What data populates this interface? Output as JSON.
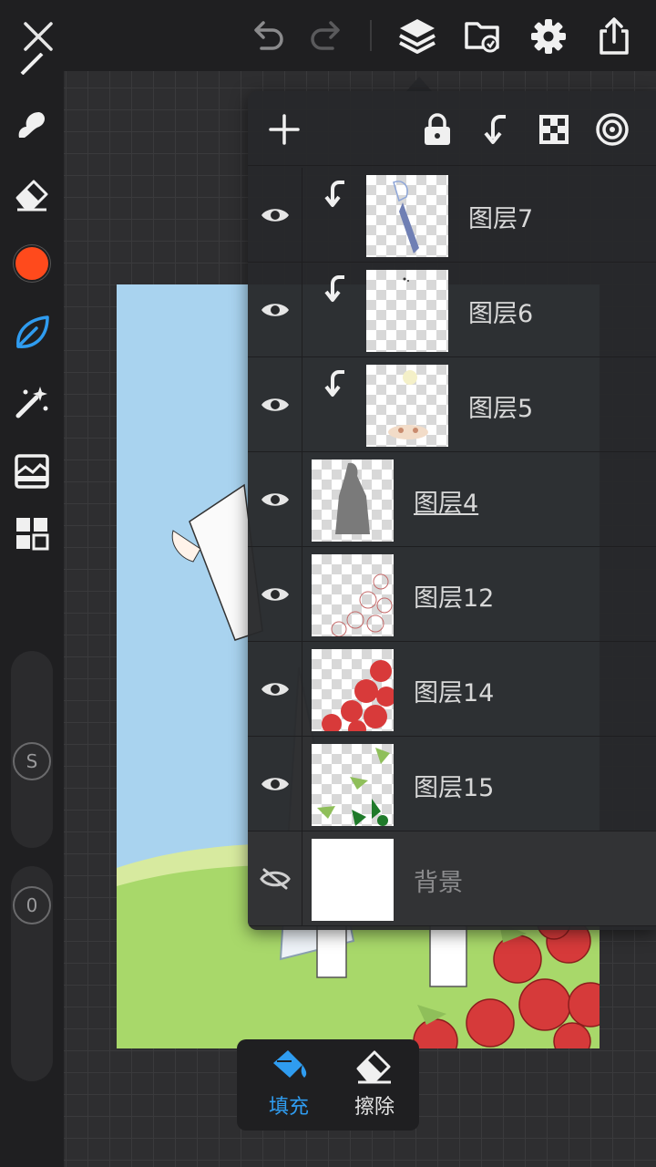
{
  "topbar": {
    "icons": [
      "close-icon",
      "undo-icon",
      "redo-icon",
      "layers-icon",
      "folder-icon",
      "gear-icon",
      "share-icon"
    ]
  },
  "toolbar": {
    "tools": [
      "brush-icon",
      "smudge-icon",
      "eraser-icon",
      "color-swatch",
      "leaf-icon",
      "magic-wand-icon",
      "image-adjust-icon",
      "grid-icon"
    ],
    "active_color": "#ff4a1c",
    "accent_color": "#2f9cf0",
    "size_slider_label": "S",
    "opacity_slider_label": "0"
  },
  "layers_panel": {
    "header_icons": [
      "add-icon",
      "lock-icon",
      "clip-icon",
      "transparency-icon",
      "blend-icon"
    ],
    "layers": [
      {
        "name": "图层7",
        "visible": true,
        "clipped": true,
        "selected": false
      },
      {
        "name": "图层6",
        "visible": true,
        "clipped": true,
        "selected": false
      },
      {
        "name": "图层5",
        "visible": true,
        "clipped": true,
        "selected": false
      },
      {
        "name": "图层4",
        "visible": true,
        "clipped": false,
        "selected": true
      },
      {
        "name": "图层12",
        "visible": true,
        "clipped": false,
        "selected": false
      },
      {
        "name": "图层14",
        "visible": true,
        "clipped": false,
        "selected": false
      },
      {
        "name": "图层15",
        "visible": true,
        "clipped": false,
        "selected": false
      },
      {
        "name": "背景",
        "visible": false,
        "clipped": false,
        "selected": false
      }
    ]
  },
  "fill_popup": {
    "fill_label": "填充",
    "erase_label": "擦除",
    "active": "fill"
  }
}
